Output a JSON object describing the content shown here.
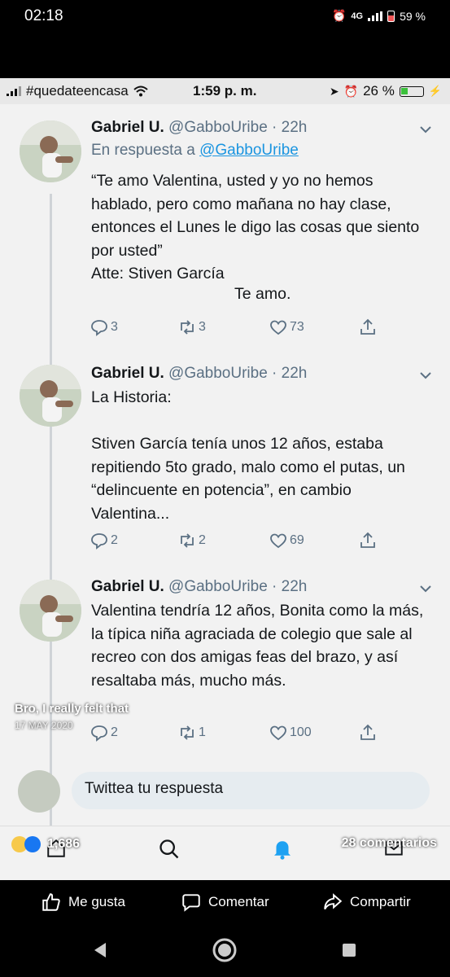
{
  "outer_status": {
    "time": "02:18",
    "network": "4G",
    "battery": "59 %"
  },
  "inner_status": {
    "carrier": "#quedateencasa",
    "time": "1:59 p. m.",
    "battery": "26 %"
  },
  "tweets": [
    {
      "name": "Gabriel U.",
      "handle": "@GabboUribe · 22h",
      "reply_prefix": "En respuesta a ",
      "reply_to": "@GabboUribe",
      "text": "“Te amo Valentina, usted y yo no hemos hablado, pero como mañana no hay clase, entonces el Lunes le digo las cosas que siento por usted”\nAtte: Stiven García",
      "text_center": "Te amo.",
      "replies": "3",
      "retweets": "3",
      "likes": "73"
    },
    {
      "name": "Gabriel U.",
      "handle": "@GabboUribe · 22h",
      "text": "La Historia:\n\nStiven García tenía unos 12 años, estaba repitiendo 5to grado, malo como el putas, un “delincuente en potencia”, en cambio Valentina...",
      "replies": "2",
      "retweets": "2",
      "likes": "69"
    },
    {
      "name": "Gabriel U.",
      "handle": "@GabboUribe · 22h",
      "text": "Valentina tendría 12 años, Bonita como la más, la típica niña agraciada de colegio que sale al recreo con dos amigas feas del brazo, y así resaltaba más, mucho más.",
      "replies": "2",
      "retweets": "1",
      "likes": "100"
    }
  ],
  "reply_placeholder": "Twittea tu respuesta",
  "overlay": {
    "title": "Bro, I really felt that",
    "date": "17 MAY 2020"
  },
  "reactions_count": "1,686",
  "comments_count": "28 comentarios",
  "fb_actions": {
    "like": "Me gusta",
    "comment": "Comentar",
    "share": "Compartir"
  },
  "colors": {
    "link": "#1b95e0",
    "muted": "#5b7083",
    "text": "#14171a",
    "notify": "#1da1f2"
  }
}
